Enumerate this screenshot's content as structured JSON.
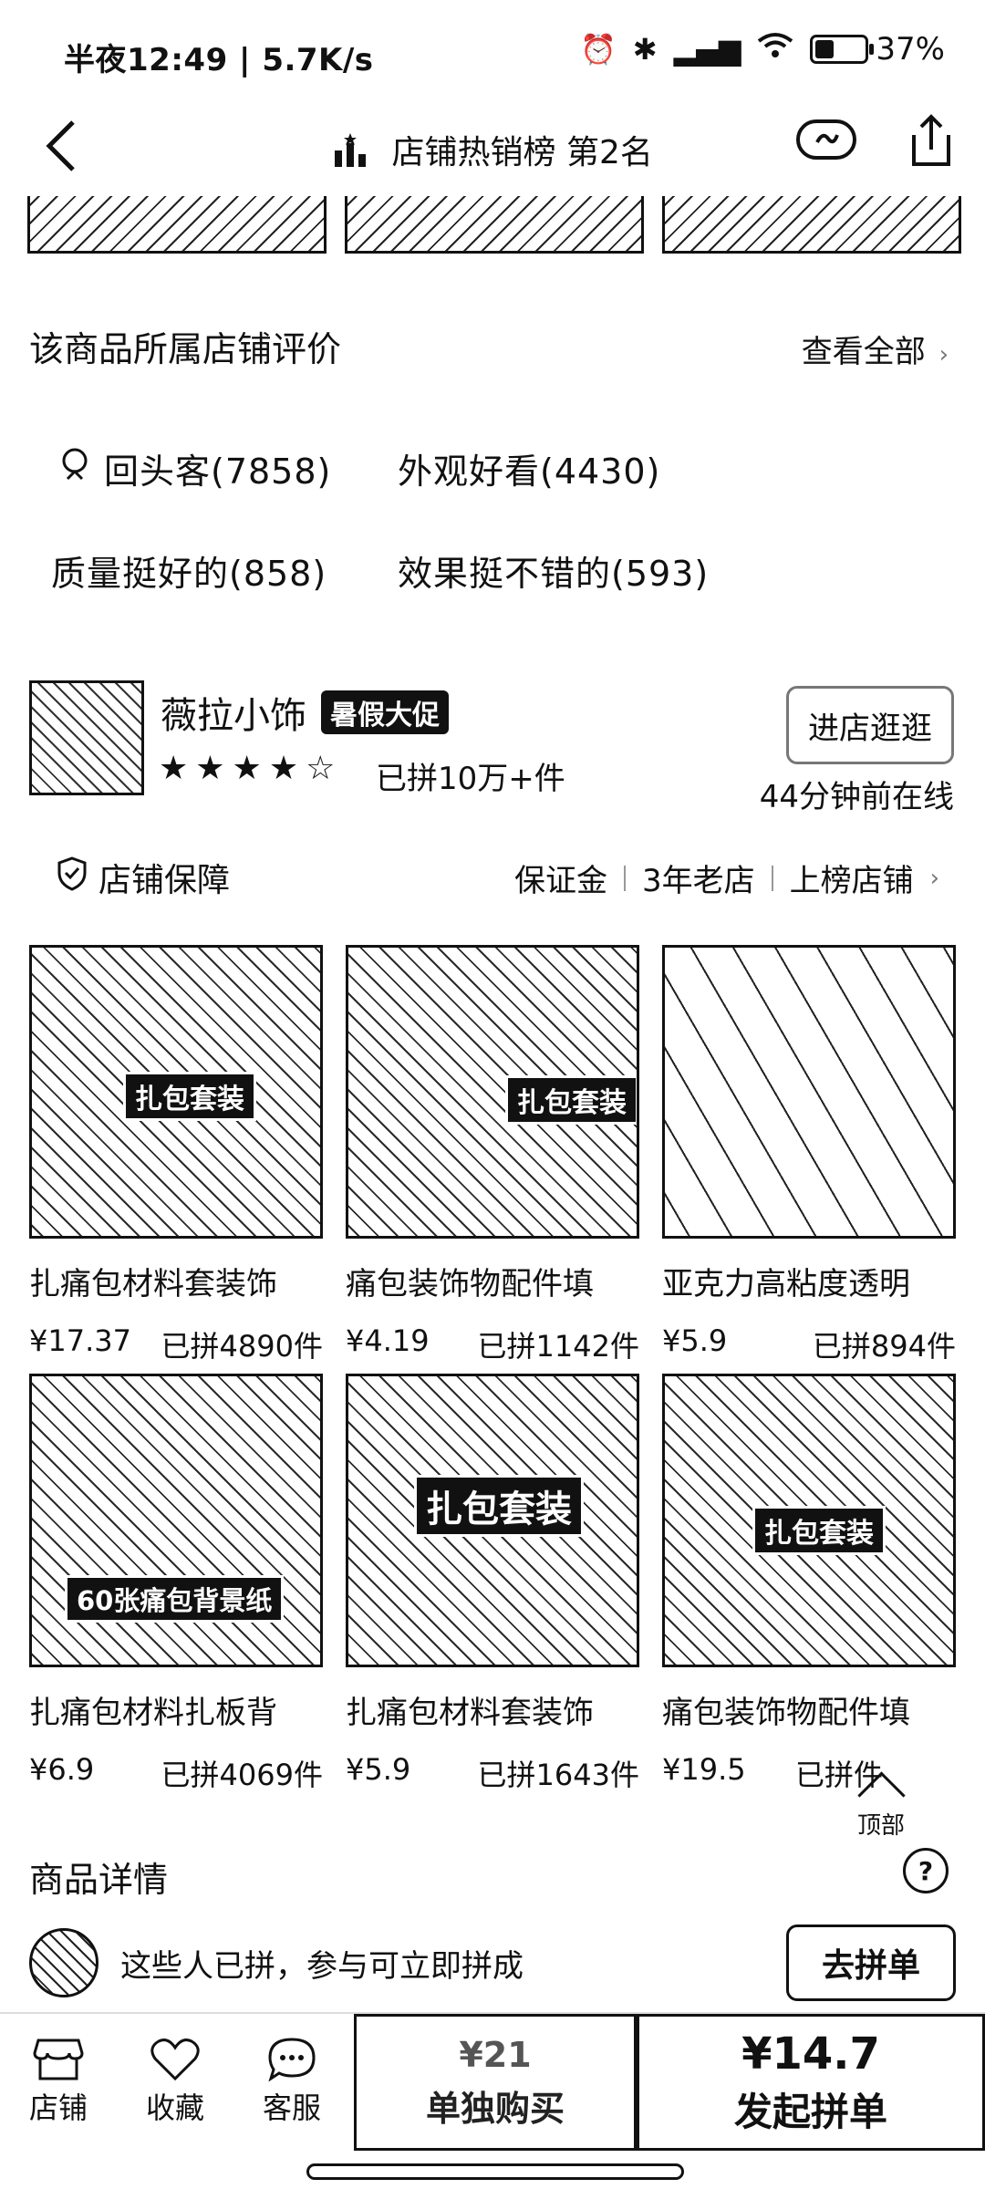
{
  "status": {
    "time": "半夜12:49 | 5.7K/s",
    "battery": "37%",
    "battery_level": 0.37
  },
  "nav": {
    "title": "店铺热销榜 第2名"
  },
  "reviews": {
    "title": "该商品所属店铺评价",
    "see_all": "查看全部",
    "tags": [
      "回头客(7858)",
      "外观好看(4430)",
      "质量挺好的(858)",
      "效果挺不错的(593)"
    ]
  },
  "shop": {
    "name": "薇拉小饰",
    "promo": "暑假大促",
    "rating_stars": 4.5,
    "stars_text": "★★★★☆",
    "sold": "已拼10万+件",
    "enter_label": "进店逛逛",
    "online": "44分钟前在线",
    "guarantee_label": "店铺保障",
    "guarantee_tags": [
      "保证金",
      "3年老店",
      "上榜店铺"
    ]
  },
  "products": [
    {
      "name": "扎痛包材料套装饰",
      "price": "¥17.37",
      "sold": "已拼4890件",
      "overlay": "扎包套装"
    },
    {
      "name": "痛包装饰物配件填",
      "price": "¥4.19",
      "sold": "已拼1142件",
      "overlay": "扎包套装"
    },
    {
      "name": "亚克力高粘度透明",
      "price": "¥5.9",
      "sold": "已拼894件",
      "overlay": ""
    },
    {
      "name": "扎痛包材料扎板背",
      "price": "¥6.9",
      "sold": "已拼4069件",
      "overlay": "60张痛包背景纸"
    },
    {
      "name": "扎痛包材料套装饰",
      "price": "¥5.9",
      "sold": "已拼1643件",
      "overlay": "扎包套装"
    },
    {
      "name": "痛包装饰物配件填",
      "price": "¥19.5",
      "sold": "已拼件",
      "overlay": "扎包套装"
    }
  ],
  "top_button": "顶部",
  "detail": {
    "title": "商品详情",
    "join_text": "这些人已拼，参与可立即拼成",
    "join_button": "去拼单"
  },
  "bottom": {
    "tabs": [
      "店铺",
      "收藏",
      "客服"
    ],
    "single_price": "¥21",
    "single_label": "单独购买",
    "group_price": "¥14.7",
    "group_label": "发起拼单"
  }
}
